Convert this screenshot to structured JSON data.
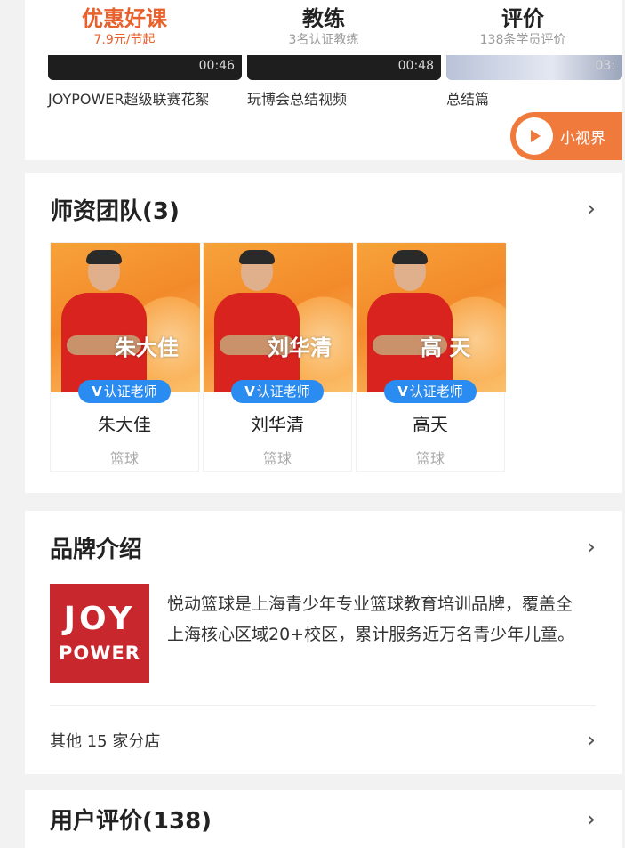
{
  "tabs": [
    {
      "title": "优惠好课",
      "subtitle": "7.9元/节起",
      "active": true
    },
    {
      "title": "教练",
      "subtitle": "3名认证教练",
      "active": false
    },
    {
      "title": "评价",
      "subtitle": "138条学员评价",
      "active": false
    }
  ],
  "videos": [
    {
      "title": "JOYPOWER超级联赛花絮",
      "duration": "00:46"
    },
    {
      "title": "玩博会总结视频",
      "duration": "00:48"
    },
    {
      "title": "总结篇",
      "duration": "03:"
    }
  ],
  "mini_window": {
    "label": "小视界",
    "icon": "play-icon"
  },
  "teachers_section": {
    "title": "师资团队(3)",
    "badge_label": "认证老师",
    "teachers": [
      {
        "name": "朱大佳",
        "overlay_name": "朱大佳",
        "sport": "篮球"
      },
      {
        "name": "刘华清",
        "overlay_name": "刘华清",
        "sport": "篮球"
      },
      {
        "name": "高天",
        "overlay_name": "高 天",
        "sport": "篮球"
      }
    ]
  },
  "brand_section": {
    "title": "品牌介绍",
    "logo_line1": "JOY",
    "logo_line2": "POWER",
    "description": "悦动篮球是上海青少年专业篮球教育培训品牌，覆盖全上海核心区域20+校区，累计服务近万名青少年儿童。",
    "branches_label": "其他 15 家分店"
  },
  "reviews_section": {
    "title": "用户评价(138)"
  },
  "colors": {
    "accent": "#e8602c",
    "badge": "#2a8cf0",
    "logo": "#c8272d"
  }
}
